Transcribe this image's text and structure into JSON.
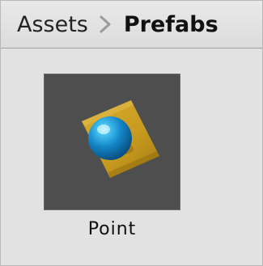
{
  "breadcrumb": {
    "items": [
      {
        "label": "Assets",
        "current": false
      },
      {
        "label": "Prefabs",
        "current": true
      }
    ],
    "separator_icon": "chevron-right-icon"
  },
  "assets": [
    {
      "label": "Point",
      "icon": "prefab-sphere-cube-icon"
    }
  ],
  "colors": {
    "panel_background": "#e2e2e2",
    "breadcrumb_background": "#e0e0e0",
    "tile_background": "#4e4e4e",
    "cube_color": "#c9a12a",
    "sphere_color": "#1591d4"
  }
}
